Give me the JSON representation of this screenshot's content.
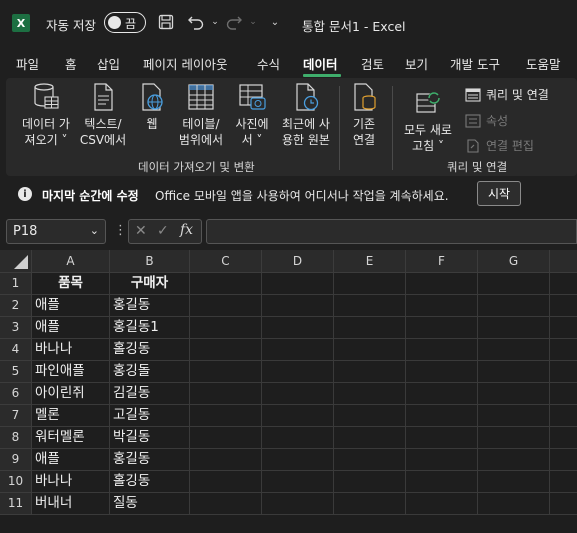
{
  "titlebar": {
    "app_icon": "X",
    "autosave_label": "자동 저장",
    "autosave_state": "끔",
    "doc_title": "통합 문서1  -  Excel"
  },
  "tabs": [
    "파일",
    "홈",
    "삽입",
    "페이지 레이아웃",
    "수식",
    "데이터",
    "검토",
    "보기",
    "개발 도구",
    "도움말"
  ],
  "active_tab": "데이터",
  "ribbon": {
    "get_data_label": "데이터 가\n져오기 ˅",
    "text_csv_label": "텍스트/\nCSV에서",
    "web_label": "웹",
    "table_range_label": "테이블/\n범위에서",
    "picture_label": "사진에\n서 ˅",
    "recent_sources_label": "최근에 사\n용한 원본",
    "existing_connections_label": "기존\n연결",
    "group1_label": "데이터 가져오기 및 변환",
    "refresh_all_label": "모두 새로\n고침 ˅",
    "queries_connections_label": "쿼리 및 연결",
    "properties_label": "속성",
    "edit_links_label": "연결 편집",
    "group2_label": "쿼리 및 연결"
  },
  "infobar": {
    "title": "마지막 순간에 수정",
    "message": "Office 모바일 앱을 사용하여 어디서나 작업을 계속하세요.",
    "button": "시작"
  },
  "formula_bar": {
    "name_box": "P18",
    "fx": "fx",
    "formula": ""
  },
  "sheet": {
    "columns": [
      "A",
      "B",
      "C",
      "D",
      "E",
      "F",
      "G"
    ],
    "rows": [
      "1",
      "2",
      "3",
      "4",
      "5",
      "6",
      "7",
      "8",
      "9",
      "10",
      "11"
    ],
    "data": [
      [
        "품목",
        "구매자"
      ],
      [
        "애플",
        "홍길동"
      ],
      [
        "애플",
        "홍길동1"
      ],
      [
        "바나나",
        "홀깅동"
      ],
      [
        "파인애플",
        "홍깅돌"
      ],
      [
        "아이린쥐",
        "김길동"
      ],
      [
        "멜론",
        "고길동"
      ],
      [
        "워터멜론",
        "박길동"
      ],
      [
        "애플",
        "홍길동"
      ],
      [
        "바나나",
        "홀깅동"
      ],
      [
        "버내너",
        "질동"
      ]
    ]
  }
}
